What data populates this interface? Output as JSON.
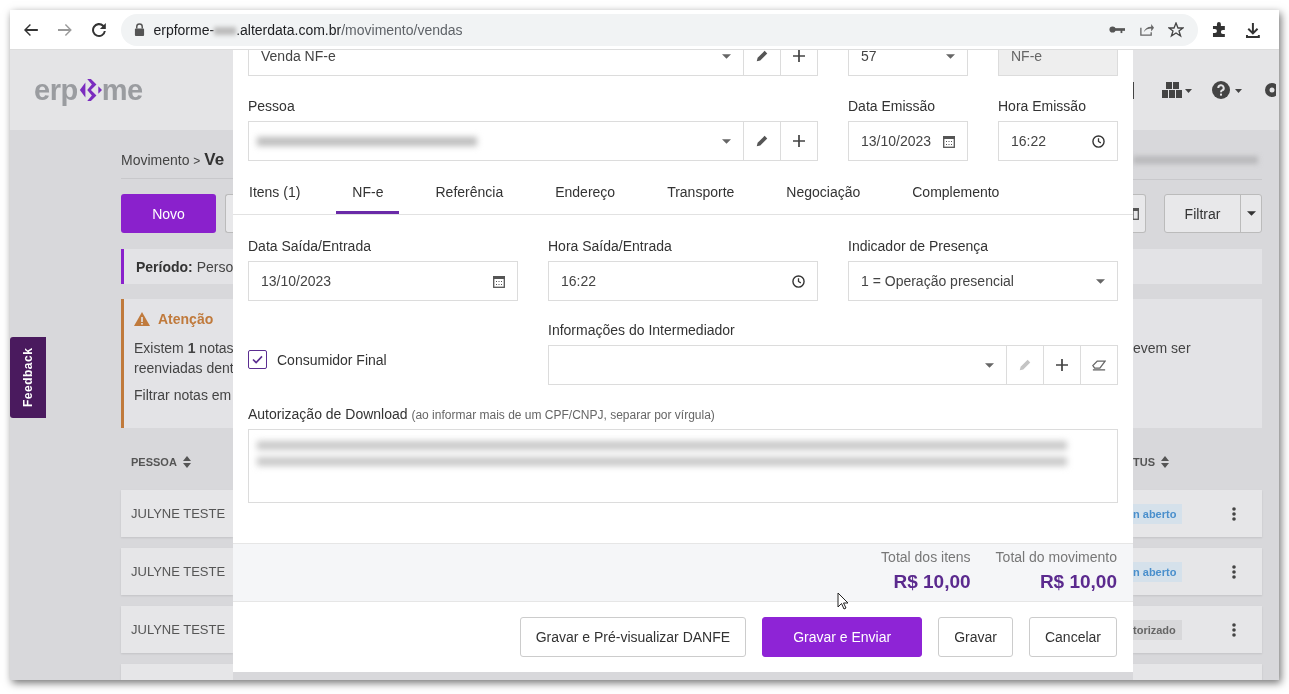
{
  "browser": {
    "url_host_start": "erpforme-",
    "url_host_end": ".alterdata.com.br",
    "url_path": "/movimento/vendas"
  },
  "page": {
    "logo": {
      "left": "erp",
      "right": "me"
    },
    "breadcrumb": {
      "parent": "Movimento",
      "separator": ">",
      "current": "Ve"
    },
    "new_button": "Novo",
    "period": {
      "label": "Período:",
      "value": "Perso"
    },
    "alert": {
      "title": "Atenção",
      "lines_left": [
        "Existem **1** notas",
        "reenviadas dent"
      ],
      "filter_left": "Filtrar notas em",
      "lines_right": [
        "evem ser"
      ]
    },
    "filter_button": "Filtrar",
    "table": {
      "columns": [
        {
          "label": "PESSOA"
        },
        {
          "label": "TUS"
        }
      ],
      "rows": [
        {
          "pessoa": "JULYNE TESTE",
          "status": "n aberto",
          "kind": "open"
        },
        {
          "pessoa": "JULYNE TESTE",
          "status": "n aberto",
          "kind": "open"
        },
        {
          "pessoa": "JULYNE TESTE",
          "status": "torizado",
          "kind": "done"
        }
      ]
    },
    "feedback": "Feedback"
  },
  "modal": {
    "top_row": {
      "operation": "Venda NF-e",
      "series": "57",
      "model": "NF-e"
    },
    "pessoa": {
      "label": "Pessoa"
    },
    "data_emissao": {
      "label": "Data Emissão",
      "value": "13/10/2023"
    },
    "hora_emissao": {
      "label": "Hora Emissão",
      "value": "16:22"
    },
    "tabs": [
      {
        "label": "Itens (1)",
        "selected": false
      },
      {
        "label": "NF-e",
        "selected": true
      },
      {
        "label": "Referência",
        "selected": false
      },
      {
        "label": "Endereço",
        "selected": false
      },
      {
        "label": "Transporte",
        "selected": false
      },
      {
        "label": "Negociação",
        "selected": false
      },
      {
        "label": "Complemento",
        "selected": false
      }
    ],
    "data_saida": {
      "label": "Data Saída/Entrada",
      "value": "13/10/2023"
    },
    "hora_saida": {
      "label": "Hora Saída/Entrada",
      "value": "16:22"
    },
    "indicador": {
      "label": "Indicador de Presença",
      "value": "1 = Operação presencial"
    },
    "consumidor_final": {
      "label": "Consumidor Final",
      "checked": true
    },
    "intermediador": {
      "label": "Informações do Intermediador",
      "edit_disabled": true
    },
    "autorizacao": {
      "label": "Autorização de Download",
      "hint": "(ao informar mais de um CPF/CNPJ, separar por vírgula)"
    },
    "totals": [
      {
        "label": "Total dos itens",
        "value": "R$ 10,00"
      },
      {
        "label": "Total do movimento",
        "value": "R$ 10,00"
      }
    ],
    "buttons": [
      {
        "label": "Gravar e Pré-visualizar DANFE",
        "kind": "secondary"
      },
      {
        "label": "Gravar e Enviar",
        "kind": "primary"
      },
      {
        "label": "Gravar",
        "kind": "secondary"
      },
      {
        "label": "Cancelar",
        "kind": "secondary"
      }
    ]
  }
}
